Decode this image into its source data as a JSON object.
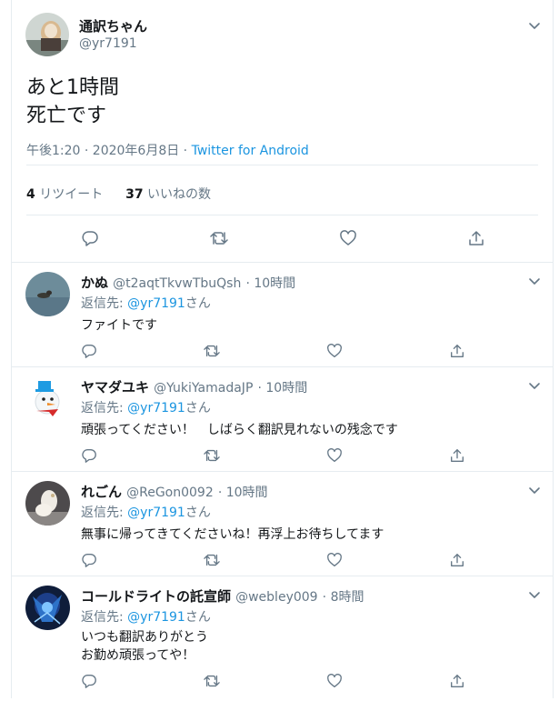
{
  "main_tweet": {
    "display_name": "通訳ちゃん",
    "handle": "@yr7191",
    "lines": [
      "あと1時間",
      "死亡です"
    ],
    "time": "午後1:20 · 2020年6月8日",
    "dot": " · ",
    "source": "Twitter for Android",
    "retweet_count": "4",
    "retweet_label": "リツイート",
    "like_count": "37",
    "like_label": "いいねの数"
  },
  "replies": [
    {
      "name": "かぬ",
      "handle": "@t2aqtTkvwTbuQsh",
      "time": "· 10時間",
      "reply_to_label": "返信先:",
      "reply_to_handle": "@yr7191",
      "reply_to_suffix": "さん",
      "lines": [
        "ファイトです"
      ]
    },
    {
      "name": "ヤマダユキ",
      "handle": "@YukiYamadaJP",
      "time": "· 10時間",
      "reply_to_label": "返信先:",
      "reply_to_handle": "@yr7191",
      "reply_to_suffix": "さん",
      "lines": [
        "頑張ってください！　しばらく翻訳見れないの残念です"
      ]
    },
    {
      "name": "れごん",
      "handle": "@ReGon0092",
      "time": "· 10時間",
      "reply_to_label": "返信先:",
      "reply_to_handle": "@yr7191",
      "reply_to_suffix": "さん",
      "lines": [
        "無事に帰ってきてくださいね！再浮上お待ちしてます"
      ]
    },
    {
      "name": "コールドライトの託宣師",
      "handle": "@webley009",
      "time": "· 8時間",
      "reply_to_label": "返信先:",
      "reply_to_handle": "@yr7191",
      "reply_to_suffix": "さん",
      "lines": [
        "いつも翻訳ありがとう",
        "お勤め頑張ってや！"
      ]
    }
  ],
  "colors": {
    "link": "#1b95e0",
    "secondary": "#657786",
    "border": "#e6ecf0"
  },
  "icons": [
    "chevron-down-icon",
    "reply-icon",
    "retweet-icon",
    "like-icon",
    "share-icon"
  ]
}
